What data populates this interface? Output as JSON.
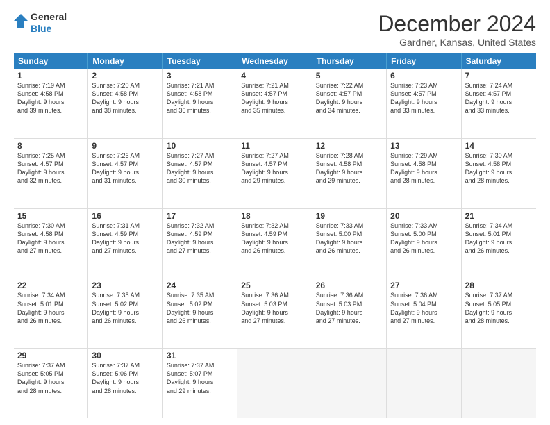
{
  "header": {
    "logo_line1": "General",
    "logo_line2": "Blue",
    "month_title": "December 2024",
    "location": "Gardner, Kansas, United States"
  },
  "weekdays": [
    "Sunday",
    "Monday",
    "Tuesday",
    "Wednesday",
    "Thursday",
    "Friday",
    "Saturday"
  ],
  "rows": [
    [
      {
        "day": "1",
        "lines": [
          "Sunrise: 7:19 AM",
          "Sunset: 4:58 PM",
          "Daylight: 9 hours",
          "and 39 minutes."
        ]
      },
      {
        "day": "2",
        "lines": [
          "Sunrise: 7:20 AM",
          "Sunset: 4:58 PM",
          "Daylight: 9 hours",
          "and 38 minutes."
        ]
      },
      {
        "day": "3",
        "lines": [
          "Sunrise: 7:21 AM",
          "Sunset: 4:58 PM",
          "Daylight: 9 hours",
          "and 36 minutes."
        ]
      },
      {
        "day": "4",
        "lines": [
          "Sunrise: 7:21 AM",
          "Sunset: 4:57 PM",
          "Daylight: 9 hours",
          "and 35 minutes."
        ]
      },
      {
        "day": "5",
        "lines": [
          "Sunrise: 7:22 AM",
          "Sunset: 4:57 PM",
          "Daylight: 9 hours",
          "and 34 minutes."
        ]
      },
      {
        "day": "6",
        "lines": [
          "Sunrise: 7:23 AM",
          "Sunset: 4:57 PM",
          "Daylight: 9 hours",
          "and 33 minutes."
        ]
      },
      {
        "day": "7",
        "lines": [
          "Sunrise: 7:24 AM",
          "Sunset: 4:57 PM",
          "Daylight: 9 hours",
          "and 33 minutes."
        ]
      }
    ],
    [
      {
        "day": "8",
        "lines": [
          "Sunrise: 7:25 AM",
          "Sunset: 4:57 PM",
          "Daylight: 9 hours",
          "and 32 minutes."
        ]
      },
      {
        "day": "9",
        "lines": [
          "Sunrise: 7:26 AM",
          "Sunset: 4:57 PM",
          "Daylight: 9 hours",
          "and 31 minutes."
        ]
      },
      {
        "day": "10",
        "lines": [
          "Sunrise: 7:27 AM",
          "Sunset: 4:57 PM",
          "Daylight: 9 hours",
          "and 30 minutes."
        ]
      },
      {
        "day": "11",
        "lines": [
          "Sunrise: 7:27 AM",
          "Sunset: 4:57 PM",
          "Daylight: 9 hours",
          "and 29 minutes."
        ]
      },
      {
        "day": "12",
        "lines": [
          "Sunrise: 7:28 AM",
          "Sunset: 4:58 PM",
          "Daylight: 9 hours",
          "and 29 minutes."
        ]
      },
      {
        "day": "13",
        "lines": [
          "Sunrise: 7:29 AM",
          "Sunset: 4:58 PM",
          "Daylight: 9 hours",
          "and 28 minutes."
        ]
      },
      {
        "day": "14",
        "lines": [
          "Sunrise: 7:30 AM",
          "Sunset: 4:58 PM",
          "Daylight: 9 hours",
          "and 28 minutes."
        ]
      }
    ],
    [
      {
        "day": "15",
        "lines": [
          "Sunrise: 7:30 AM",
          "Sunset: 4:58 PM",
          "Daylight: 9 hours",
          "and 27 minutes."
        ]
      },
      {
        "day": "16",
        "lines": [
          "Sunrise: 7:31 AM",
          "Sunset: 4:59 PM",
          "Daylight: 9 hours",
          "and 27 minutes."
        ]
      },
      {
        "day": "17",
        "lines": [
          "Sunrise: 7:32 AM",
          "Sunset: 4:59 PM",
          "Daylight: 9 hours",
          "and 27 minutes."
        ]
      },
      {
        "day": "18",
        "lines": [
          "Sunrise: 7:32 AM",
          "Sunset: 4:59 PM",
          "Daylight: 9 hours",
          "and 26 minutes."
        ]
      },
      {
        "day": "19",
        "lines": [
          "Sunrise: 7:33 AM",
          "Sunset: 5:00 PM",
          "Daylight: 9 hours",
          "and 26 minutes."
        ]
      },
      {
        "day": "20",
        "lines": [
          "Sunrise: 7:33 AM",
          "Sunset: 5:00 PM",
          "Daylight: 9 hours",
          "and 26 minutes."
        ]
      },
      {
        "day": "21",
        "lines": [
          "Sunrise: 7:34 AM",
          "Sunset: 5:01 PM",
          "Daylight: 9 hours",
          "and 26 minutes."
        ]
      }
    ],
    [
      {
        "day": "22",
        "lines": [
          "Sunrise: 7:34 AM",
          "Sunset: 5:01 PM",
          "Daylight: 9 hours",
          "and 26 minutes."
        ]
      },
      {
        "day": "23",
        "lines": [
          "Sunrise: 7:35 AM",
          "Sunset: 5:02 PM",
          "Daylight: 9 hours",
          "and 26 minutes."
        ]
      },
      {
        "day": "24",
        "lines": [
          "Sunrise: 7:35 AM",
          "Sunset: 5:02 PM",
          "Daylight: 9 hours",
          "and 26 minutes."
        ]
      },
      {
        "day": "25",
        "lines": [
          "Sunrise: 7:36 AM",
          "Sunset: 5:03 PM",
          "Daylight: 9 hours",
          "and 27 minutes."
        ]
      },
      {
        "day": "26",
        "lines": [
          "Sunrise: 7:36 AM",
          "Sunset: 5:03 PM",
          "Daylight: 9 hours",
          "and 27 minutes."
        ]
      },
      {
        "day": "27",
        "lines": [
          "Sunrise: 7:36 AM",
          "Sunset: 5:04 PM",
          "Daylight: 9 hours",
          "and 27 minutes."
        ]
      },
      {
        "day": "28",
        "lines": [
          "Sunrise: 7:37 AM",
          "Sunset: 5:05 PM",
          "Daylight: 9 hours",
          "and 28 minutes."
        ]
      }
    ],
    [
      {
        "day": "29",
        "lines": [
          "Sunrise: 7:37 AM",
          "Sunset: 5:05 PM",
          "Daylight: 9 hours",
          "and 28 minutes."
        ]
      },
      {
        "day": "30",
        "lines": [
          "Sunrise: 7:37 AM",
          "Sunset: 5:06 PM",
          "Daylight: 9 hours",
          "and 28 minutes."
        ]
      },
      {
        "day": "31",
        "lines": [
          "Sunrise: 7:37 AM",
          "Sunset: 5:07 PM",
          "Daylight: 9 hours",
          "and 29 minutes."
        ]
      },
      null,
      null,
      null,
      null
    ]
  ]
}
